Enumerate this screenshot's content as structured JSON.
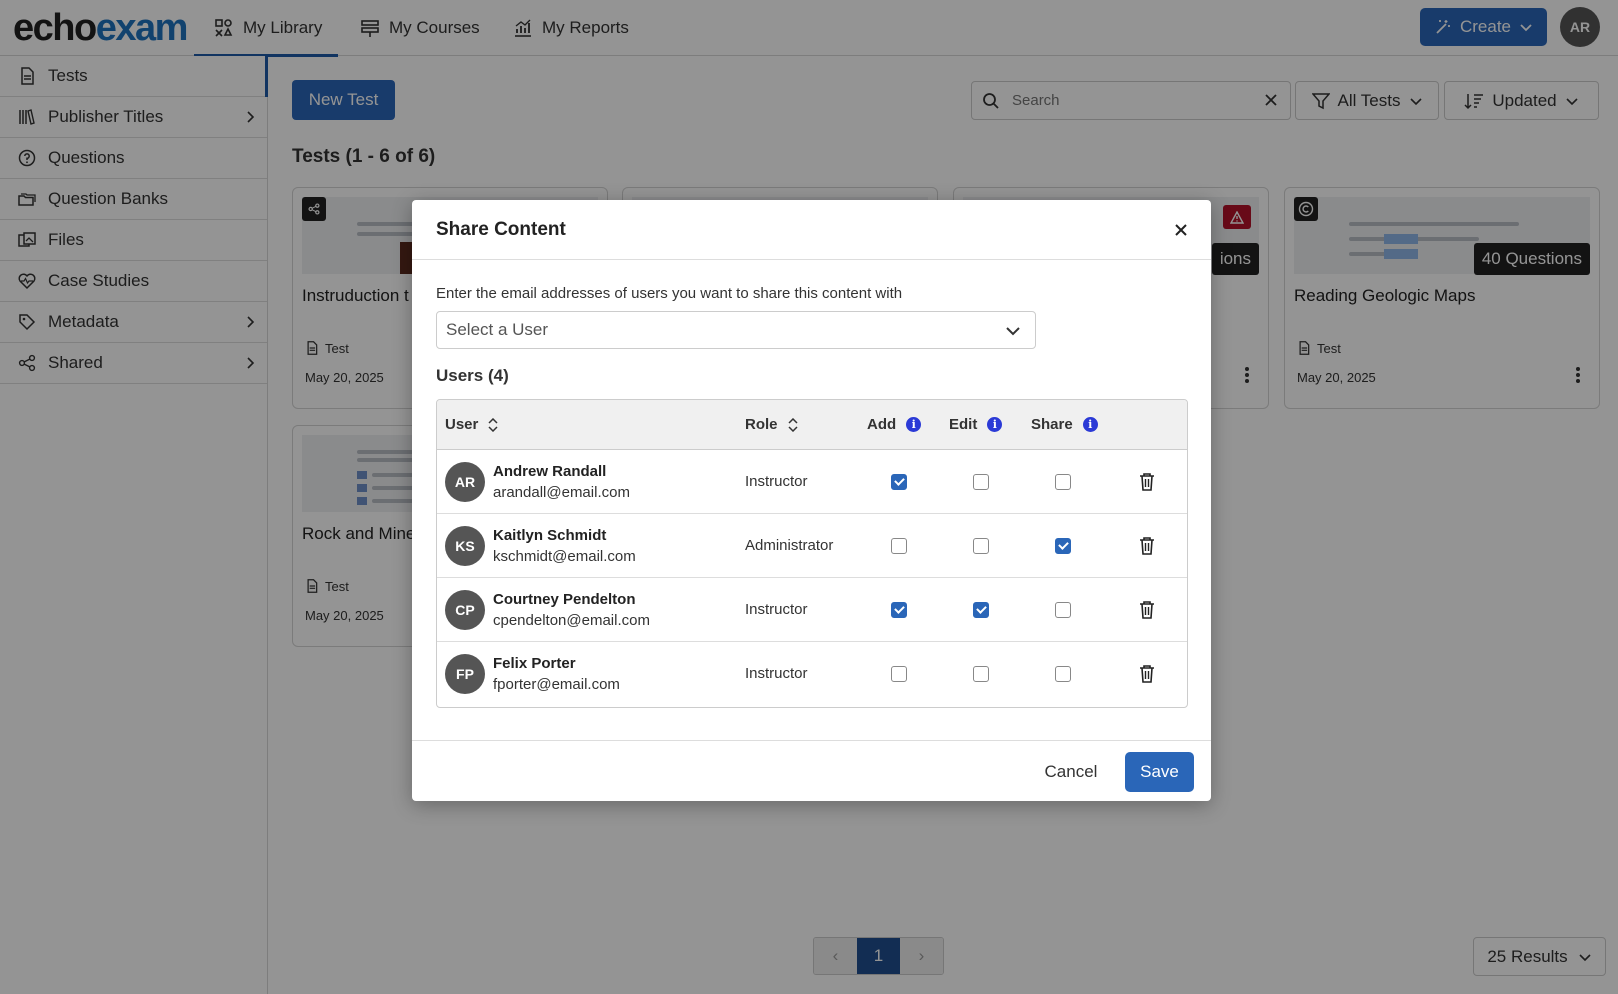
{
  "header": {
    "logo_part1": "echo",
    "logo_part2": "exam",
    "nav": [
      {
        "label": "My Library",
        "icon": "library-icon"
      },
      {
        "label": "My Courses",
        "icon": "courses-icon"
      },
      {
        "label": "My Reports",
        "icon": "reports-icon"
      }
    ],
    "create_label": "Create",
    "user_initials": "AR"
  },
  "sidebar": {
    "items": [
      {
        "label": "Tests",
        "icon": "test-document-icon",
        "active": true
      },
      {
        "label": "Publisher Titles",
        "icon": "books-icon",
        "has_children": true
      },
      {
        "label": "Questions",
        "icon": "question-icon"
      },
      {
        "label": "Question Banks",
        "icon": "folders-icon"
      },
      {
        "label": "Files",
        "icon": "files-icon"
      },
      {
        "label": "Case Studies",
        "icon": "heartbeat-icon"
      },
      {
        "label": "Metadata",
        "icon": "tag-icon",
        "has_children": true
      },
      {
        "label": "Shared",
        "icon": "share-icon",
        "has_children": true
      }
    ]
  },
  "toolbar": {
    "new_test_label": "New Test",
    "search_placeholder": "Search",
    "filter_label": "All Tests",
    "sort_label": "Updated"
  },
  "main": {
    "heading": "Tests (1 - 6 of 6)",
    "cards": [
      {
        "title": "Instruduction t",
        "type": "Test",
        "date": "May 20, 2025"
      },
      {
        "title": "Reading Geologic Maps",
        "type": "Test",
        "date": "May 20, 2025",
        "questions": "40 Questions"
      },
      {
        "title": "Rock and Mine",
        "type": "Test",
        "date": "May 20, 2025"
      }
    ],
    "partial_badge": "ions"
  },
  "pagination": {
    "prev": "‹",
    "current": "1",
    "next": "›",
    "results_label": "25 Results"
  },
  "modal": {
    "title": "Share Content",
    "prompt": "Enter the email addresses of users you want to share this content with",
    "select_placeholder": "Select a User",
    "users_count": "Users (4)",
    "columns": {
      "user": "User",
      "role": "Role",
      "add": "Add",
      "edit": "Edit",
      "share": "Share"
    },
    "users": [
      {
        "initials": "AR",
        "name": "Andrew Randall",
        "email": "arandall@email.com",
        "role": "Instructor",
        "add": true,
        "edit": false,
        "share": false
      },
      {
        "initials": "KS",
        "name": "Kaitlyn Schmidt",
        "email": "kschmidt@email.com",
        "role": "Administrator",
        "add": false,
        "edit": false,
        "share": true
      },
      {
        "initials": "CP",
        "name": "Courtney Pendelton",
        "email": "cpendelton@email.com",
        "role": "Instructor",
        "add": true,
        "edit": true,
        "share": false
      },
      {
        "initials": "FP",
        "name": "Felix Porter",
        "email": "fporter@email.com",
        "role": "Instructor",
        "add": false,
        "edit": false,
        "share": false
      }
    ],
    "cancel_label": "Cancel",
    "save_label": "Save"
  },
  "colors": {
    "brand_blue": "#1e73be",
    "primary_button": "#2a66b8",
    "info_icon": "#2b3ad6",
    "warning_badge": "#b3122a"
  }
}
